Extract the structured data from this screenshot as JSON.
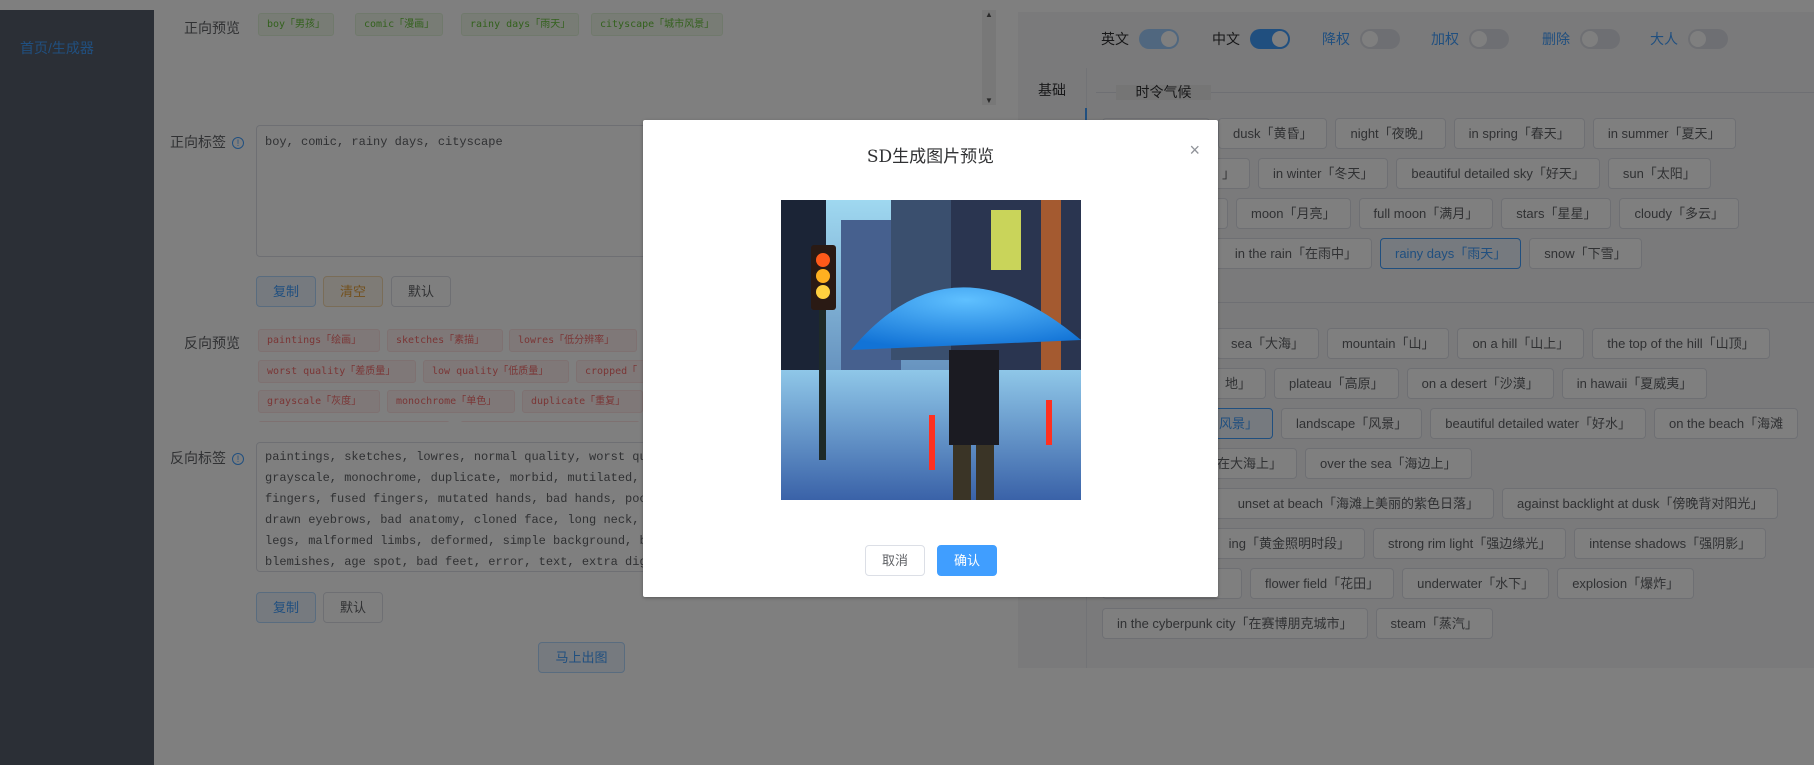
{
  "sidebar": {
    "breadcrumb": "首页/生成器"
  },
  "left": {
    "positive_preview_label": "正向预览",
    "positive_tags": [
      "boy「男孩」",
      "comic「漫画」",
      "rainy days「雨天」",
      "cityscape「城市风景」"
    ],
    "positive_label": "正向标签",
    "positive_text": "boy, comic, rainy days, cityscape",
    "copy": "复制",
    "clear": "清空",
    "default": "默认",
    "negative_preview_label": "反向预览",
    "negative_tags": [
      "paintings「绘画」",
      "sketches「素描」",
      "lowres「低分辨率」",
      "worst quality「差质量」",
      "low quality「低质量」",
      "cropped「",
      "grayscale「灰度」",
      "monochrome「单色」",
      "duplicate「重复」"
    ],
    "negative_label": "反向标签",
    "negative_lines": [
      "paintings, sketches, lowres, normal quality, worst qua",
      "grayscale, monochrome, duplicate, morbid, mutilated, m",
      "fingers, fused fingers, mutated hands, bad hands, poor",
      "drawn eyebrows, bad anatomy, cloned face, long neck, e",
      "legs, malformed limbs, deformed, simple background, ba",
      "blemishes, age spot, bad feet, error, text, extra digi"
    ],
    "generate": "马上出图",
    "info_icon": "info-icon"
  },
  "right": {
    "switches": [
      {
        "label": "英文",
        "on": true
      },
      {
        "label": "中文",
        "on": true
      },
      {
        "label": "降权",
        "on": false
      },
      {
        "label": "加权",
        "on": false
      },
      {
        "label": "删除",
        "on": false
      },
      {
        "label": "大人",
        "on": false
      }
    ],
    "tab": "基础",
    "section_title": "时令气候",
    "section1": [
      [
        {
          "text": ""
        },
        {
          "text": "dusk「黄昏」"
        },
        {
          "text": "night「夜晚」"
        },
        {
          "text": "in spring「春天」"
        },
        {
          "text": "in summer「夏天」"
        }
      ],
      [
        {
          "text": "」"
        },
        {
          "text": "in winter「冬天」"
        },
        {
          "text": "beautiful detailed sky「好天」"
        },
        {
          "text": "sun「太阳」"
        }
      ],
      [
        {
          "text": ""
        },
        {
          "text": "moon「月亮」"
        },
        {
          "text": "full moon「满月」"
        },
        {
          "text": "stars「星星」"
        },
        {
          "text": "cloudy「多云」"
        }
      ],
      [
        {
          "text": ""
        },
        {
          "text": "in the rain「在雨中」"
        },
        {
          "text": "rainy days「雨天」",
          "active": true
        },
        {
          "text": "snow「下雪」"
        }
      ]
    ],
    "section2": [
      [
        {
          "text": ""
        },
        {
          "text": "sea「大海」"
        },
        {
          "text": "mountain「山」"
        },
        {
          "text": "on a hill「山上」"
        },
        {
          "text": "the top of the hill「山顶」"
        }
      ],
      [
        {
          "text": "地」"
        },
        {
          "text": "plateau「高原」"
        },
        {
          "text": "on a desert「沙漠」"
        },
        {
          "text": "in hawaii「夏威夷」"
        }
      ],
      [
        {
          "text": "风景」",
          "active": true
        },
        {
          "text": "landscape「风景」"
        },
        {
          "text": "beautiful detailed water「好水」"
        },
        {
          "text": "on the beach「海滩"
        }
      ],
      [
        {
          "text": "在大海上」"
        },
        {
          "text": "over the sea「海边上」"
        }
      ],
      [
        {
          "text": "unset at beach「海滩上美丽的紫色日落」"
        },
        {
          "text": "against backlight at dusk「傍晚背对阳光」"
        }
      ],
      [
        {
          "text": "ing「黄金照明时段」"
        },
        {
          "text": "strong rim light「强边缘光」"
        },
        {
          "text": "intense shadows「强阴影」"
        }
      ],
      [
        {
          "text": ""
        },
        {
          "text": "flower field「花田」"
        },
        {
          "text": "underwater「水下」"
        },
        {
          "text": "explosion「爆炸」"
        }
      ],
      [
        {
          "text": "in the cyberpunk city「在赛博朋克城市」"
        },
        {
          "text": "steam「蒸汽」"
        }
      ]
    ]
  },
  "modal": {
    "title": "SD生成图片预览",
    "close_icon": "×",
    "cancel": "取消",
    "confirm": "确认"
  },
  "colors": {
    "primary": "#409eff",
    "success": "#67c23a",
    "danger": "#f56c6c",
    "warning": "#e6a23c"
  }
}
